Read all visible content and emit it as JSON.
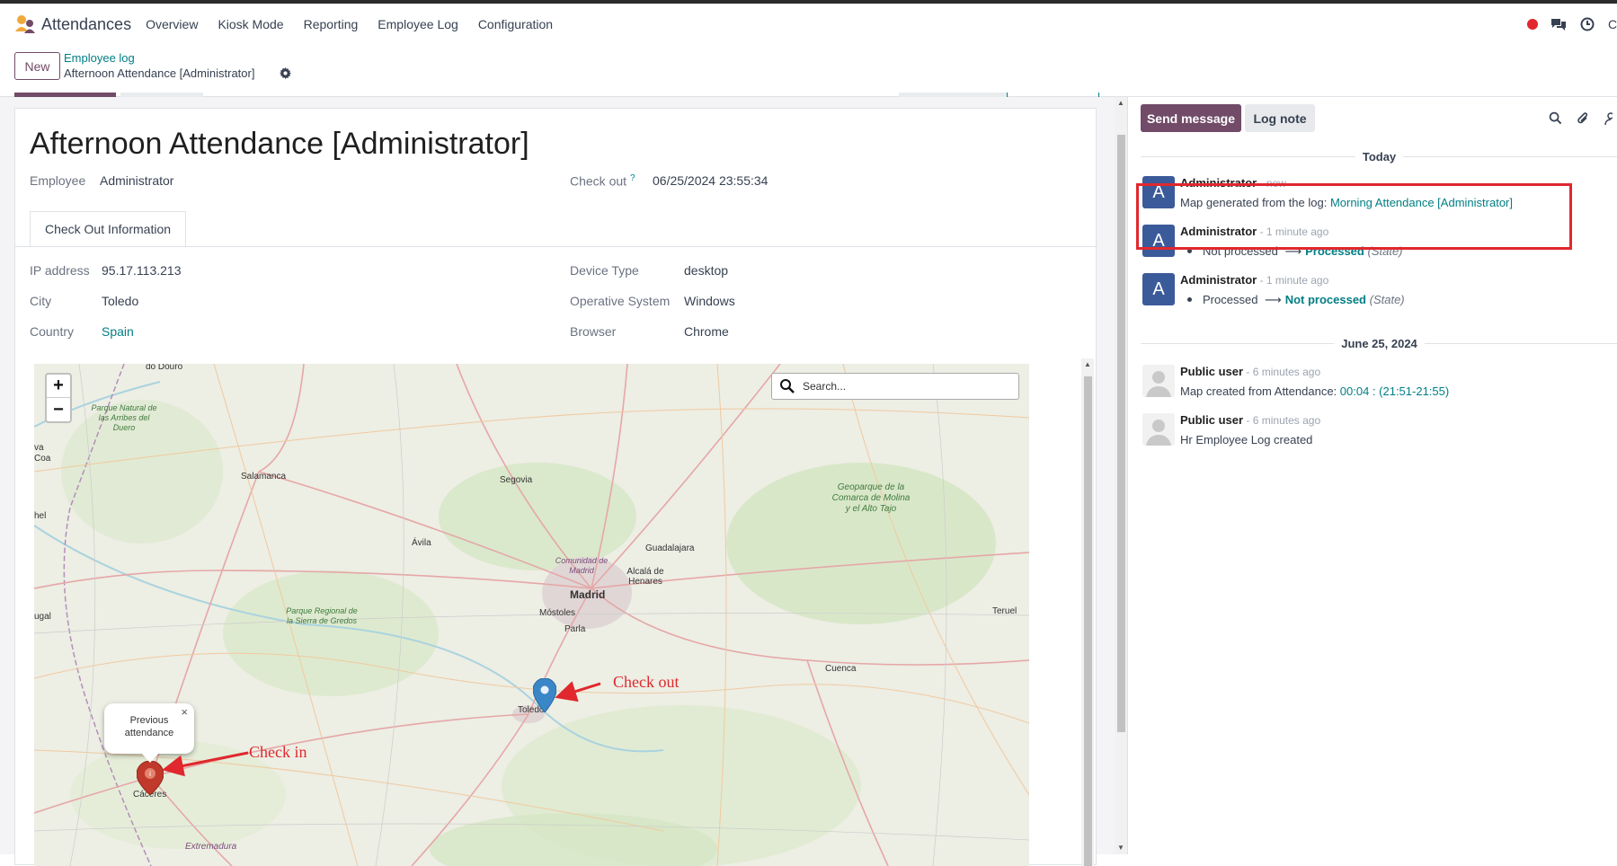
{
  "navbar": {
    "app_name": "Attendances",
    "menu": [
      "Overview",
      "Kiosk Mode",
      "Reporting",
      "Employee Log",
      "Configuration"
    ],
    "truncated_user": "C"
  },
  "control_panel": {
    "new_label": "New",
    "breadcrumb_parent": "Employee log",
    "breadcrumb_current": "Afternoon Attendance [Administrator]"
  },
  "form": {
    "title": "Afternoon Attendance [Administrator]",
    "employee_label": "Employee",
    "employee_value": "Administrator",
    "checkout_label": "Check out",
    "checkout_help": "?",
    "checkout_value": "06/25/2024 23:55:34",
    "tab_label": "Check Out Information",
    "ip_label": "IP address",
    "ip_value": "95.17.113.213",
    "city_label": "City",
    "city_value": "Toledo",
    "country_label": "Country",
    "country_value": "Spain",
    "device_label": "Device Type",
    "device_value": "desktop",
    "os_label": "Operative System",
    "os_value": "Windows",
    "browser_label": "Browser",
    "browser_value": "Chrome"
  },
  "map": {
    "zoom_in": "+",
    "zoom_out": "−",
    "search_placeholder": "Search...",
    "popup_line1": "Previous",
    "popup_line2": "attendance",
    "popup_close": "×",
    "places": [
      "do Douro",
      "Parque Natural de las Arribes del Duero",
      "Salamanca",
      "Segovia",
      "Ávila",
      "Guadalajara",
      "Comunidad de Madrid",
      "Alcalá de Henares",
      "Madrid",
      "Móstoles",
      "Parla",
      "Geoparque de la Comarca de Molina y el Alto Tajo",
      "Parque Regional de la Sierra de Gredos",
      "Toledo",
      "Cuenca",
      "Teruel",
      "Cáceres",
      "Extremadura",
      "hel",
      "ugal",
      "va",
      "Coa"
    ],
    "annotation_checkout": "Check out",
    "annotation_checkin": "Check in",
    "pin_colors": {
      "checkout": "#3a87c8",
      "checkin": "#c0392b"
    }
  },
  "chatter": {
    "send_message": "Send message",
    "log_note": "Log note",
    "today_label": "Today",
    "date2_label": "June 25, 2024",
    "messages": [
      {
        "avatar": "A",
        "author": "Administrator",
        "time": " - now",
        "text": "Map generated from the log: ",
        "link": "Morning Attendance [Administrator]"
      },
      {
        "avatar": "A",
        "author": "Administrator",
        "time": " - 1 minute ago",
        "old": "Not processed",
        "new": "Processed",
        "field": "(State)"
      },
      {
        "avatar": "A",
        "author": "Administrator",
        "time": " - 1 minute ago",
        "old": "Processed",
        "new": "Not processed",
        "field": "(State)"
      },
      {
        "author": "Public user",
        "time": " - 6 minutes ago",
        "text": "Map created from Attendance: ",
        "link": "00:04 : (21:51-21:55)"
      },
      {
        "author": "Public user",
        "time": " - 6 minutes ago",
        "text": "Hr Employee Log created"
      }
    ]
  },
  "colors": {
    "brand": "#714b67",
    "link": "#017e84",
    "annotation": "#e0282e"
  }
}
